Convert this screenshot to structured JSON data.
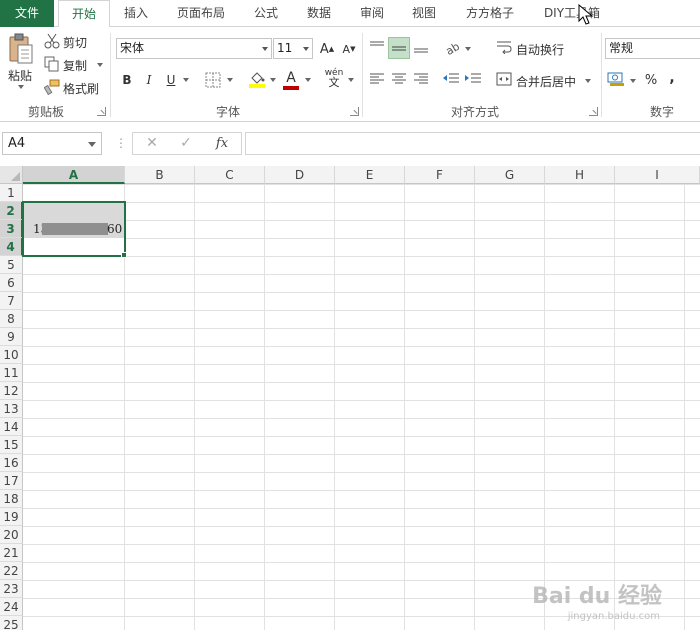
{
  "ribbon_tabs": [
    "文件",
    "开始",
    "插入",
    "页面布局",
    "公式",
    "数据",
    "审阅",
    "视图",
    "方方格子",
    "DIY工具箱"
  ],
  "clipboard": {
    "paste_label": "粘贴",
    "cut_label": "剪切",
    "copy_label": "复制",
    "format_painter_label": "格式刷",
    "group_label": "剪贴板"
  },
  "font": {
    "font_name": "宋体",
    "font_size": "11",
    "bold_label": "B",
    "italic_label": "I",
    "underline_label": "U",
    "group_label": "字体",
    "grow_label": "A",
    "shrink_label": "A",
    "font_color_label": "A",
    "phonetic_label": "wén"
  },
  "alignment": {
    "wrap_text_label": "自动换行",
    "merge_center_label": "合并后居中",
    "group_label": "对齐方式"
  },
  "number": {
    "format": "常规",
    "percent_label": "%",
    "comma_label": ",",
    "group_label": "数字"
  },
  "formula_bar": {
    "name_box": "A4",
    "fx_label": "fx",
    "cancel_label": "✕",
    "enter_label": "✓",
    "dots": "⋮",
    "formula": ""
  },
  "grid": {
    "columns": [
      "A",
      "B",
      "C",
      "D",
      "E",
      "F",
      "G",
      "H",
      "I"
    ],
    "rows": [
      "1",
      "2",
      "3",
      "4",
      "5",
      "6",
      "7",
      "8",
      "9",
      "10",
      "11",
      "12",
      "13",
      "14",
      "15",
      "16",
      "17",
      "18",
      "19",
      "20",
      "21",
      "22",
      "23",
      "24",
      "25"
    ],
    "a3_prefix": "13",
    "a3_suffix": "60"
  },
  "watermark": {
    "main": "Bai du 经验",
    "sub": "jingyan.baidu.com"
  },
  "colors": {
    "excel_green": "#217346",
    "selection_gray": "#d9d9d9",
    "font_color_bar": "#c00000",
    "fill_color_bar": "#ffff00"
  }
}
